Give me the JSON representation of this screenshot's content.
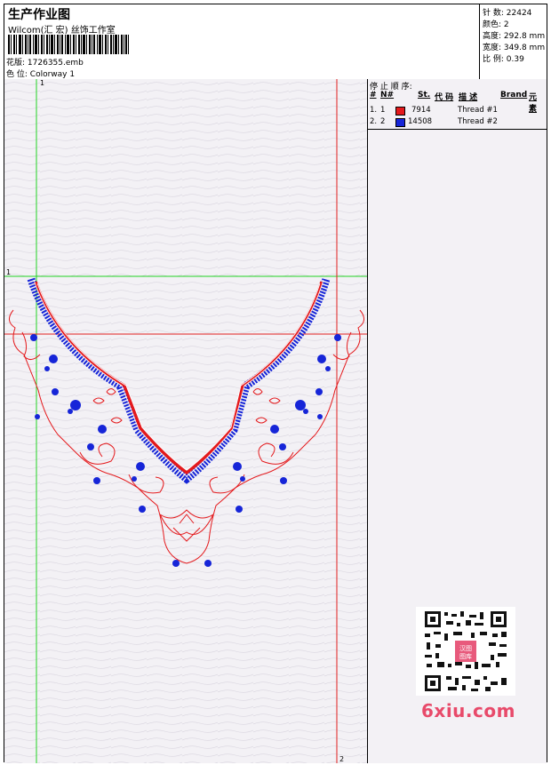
{
  "header": {
    "title": "生产作业图",
    "company": "Wilcom(汇 宏) 丝饰工作室",
    "design_label": "花版:",
    "design_value": "1726355.emb",
    "colorway_label": "色 位:",
    "colorway_value": "Colorway 1"
  },
  "stats": [
    {
      "label": "针 数:",
      "value": "22424"
    },
    {
      "label": "颜色:",
      "value": "2"
    },
    {
      "label": "高度:",
      "value": "292.8 mm"
    },
    {
      "label": "宽度:",
      "value": "349.8 mm"
    },
    {
      "label": "比 例:",
      "value": "0.39"
    }
  ],
  "sequence": {
    "title": "停 止 顺 序:",
    "headers": {
      "idx": "#",
      "no": "N#",
      "st": "St.",
      "code": "代 码",
      "desc": "描 述",
      "brand": "Brand",
      "elem": "元 素"
    },
    "rows": [
      {
        "idx": "1.",
        "no": "1",
        "color": "#e4191c",
        "code": "7914",
        "desc": "Thread #1"
      },
      {
        "idx": "2.",
        "no": "2",
        "color": "#1625d8",
        "code": "14508",
        "desc": "Thread #2"
      }
    ]
  },
  "guides": {
    "left_marker": "1",
    "top_marker": "1",
    "right_marker": "2"
  },
  "watermark": {
    "text": "6xiu.com",
    "stamp": "汉图图库"
  },
  "colors": {
    "thread1": "#e4191c",
    "thread2": "#1625d8",
    "guide_green": "#22d422",
    "guide_red": "#e02020"
  }
}
